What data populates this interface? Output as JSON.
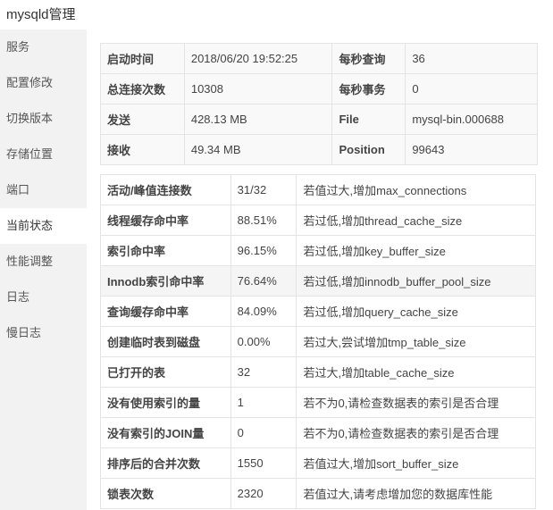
{
  "window": {
    "title": "mysqld管理"
  },
  "sidebar": {
    "items": [
      {
        "label": "服务"
      },
      {
        "label": "配置修改"
      },
      {
        "label": "切换版本"
      },
      {
        "label": "存储位置"
      },
      {
        "label": "端口"
      },
      {
        "label": "当前状态",
        "active": true
      },
      {
        "label": "性能调整"
      },
      {
        "label": "日志"
      },
      {
        "label": "慢日志"
      }
    ]
  },
  "info": {
    "rows": [
      {
        "k1": "启动时间",
        "v1": "2018/06/20 19:52:25",
        "k2": "每秒查询",
        "v2": "36"
      },
      {
        "k1": "总连接次数",
        "v1": "10308",
        "k2": "每秒事务",
        "v2": "0"
      },
      {
        "k1": "发送",
        "v1": "428.13 MB",
        "k2": "File",
        "v2": "mysql-bin.000688"
      },
      {
        "k1": "接收",
        "v1": "49.34 MB",
        "k2": "Position",
        "v2": "99643"
      }
    ]
  },
  "status": {
    "rows": [
      {
        "name": "活动/峰值连接数",
        "value": "31/32",
        "tip": "若值过大,增加max_connections"
      },
      {
        "name": "线程缓存命中率",
        "value": "88.51%",
        "tip": "若过低,增加thread_cache_size"
      },
      {
        "name": "索引命中率",
        "value": "96.15%",
        "tip": "若过低,增加key_buffer_size"
      },
      {
        "name": "Innodb索引命中率",
        "value": "76.64%",
        "tip": "若过低,增加innodb_buffer_pool_size"
      },
      {
        "name": "查询缓存命中率",
        "value": "84.09%",
        "tip": "若过低,增加query_cache_size"
      },
      {
        "name": "创建临时表到磁盘",
        "value": "0.00%",
        "tip": "若过大,尝试增加tmp_table_size"
      },
      {
        "name": "已打开的表",
        "value": "32",
        "tip": "若过大,增加table_cache_size"
      },
      {
        "name": "没有使用索引的量",
        "value": "1",
        "tip": "若不为0,请检查数据表的索引是否合理"
      },
      {
        "name": "没有索引的JOIN量",
        "value": "0",
        "tip": "若不为0,请检查数据表的索引是否合理"
      },
      {
        "name": "排序后的合并次数",
        "value": "1550",
        "tip": "若值过大,增加sort_buffer_size"
      },
      {
        "name": "锁表次数",
        "value": "2320",
        "tip": "若值过大,请考虑增加您的数据库性能"
      }
    ]
  }
}
